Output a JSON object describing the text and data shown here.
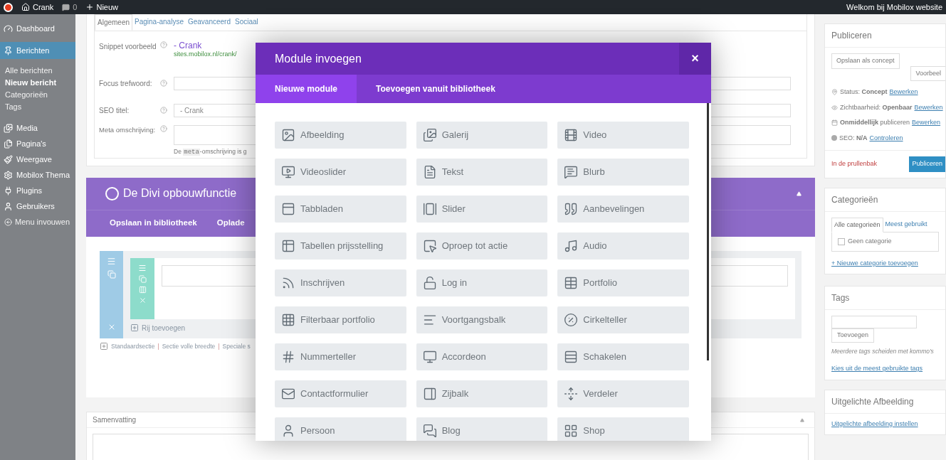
{
  "top_bar": {
    "site": "Crank",
    "comments": "0",
    "new": "Nieuw",
    "greeting": "Welkom bij Mobilox website"
  },
  "sidebar": {
    "items": [
      {
        "label": "Dashboard",
        "selected": false
      },
      {
        "label": "Berichten",
        "selected": true,
        "children": [
          {
            "label": "Alle berichten",
            "selected": false
          },
          {
            "label": "Nieuw bericht",
            "selected": true
          },
          {
            "label": "Categorieën",
            "selected": false
          },
          {
            "label": "Tags",
            "selected": false
          }
        ]
      },
      {
        "label": "Media",
        "selected": false
      },
      {
        "label": "Pagina's",
        "selected": false
      },
      {
        "label": "Weergave",
        "selected": false
      },
      {
        "label": "Mobilox Thema",
        "selected": false
      },
      {
        "label": "Plugins",
        "selected": false
      },
      {
        "label": "Gebruikers",
        "selected": false
      }
    ],
    "collapse": "Menu invouwen"
  },
  "seo_box": {
    "tabs": [
      {
        "label": "Algemeen",
        "selected": true
      },
      {
        "label": "Pagina-analyse",
        "selected": false
      },
      {
        "label": "Geavanceerd",
        "selected": false
      },
      {
        "label": "Sociaal",
        "selected": false
      }
    ],
    "snippet_label": "Snippet voorbeeld",
    "snippet_title": "- Crank",
    "snippet_url": "sites.mobilox.nl/crank/",
    "focus_label": "Focus trefwoord:",
    "seo_title_label": "SEO titel:",
    "seo_title_placeholder": "- Crank",
    "meta_label": "Meta omschrijving:",
    "meta_hint": {
      "before": "De",
      "code": "meta",
      "after": "-omschrijving is g"
    }
  },
  "divi": {
    "title": "De Divi opbouwfunctie",
    "buttons": [
      "Opslaan in bibliotheek",
      "Oplade"
    ],
    "add_row": "Rij toevoegen",
    "section_links": [
      "Standaardsectie",
      "Sectie volle breedte",
      "Speciale s"
    ],
    "separator": "|"
  },
  "excerpt": {
    "title": "Samenvatting"
  },
  "publish": {
    "title": "Publiceren",
    "save_draft": "Opslaan als concept",
    "preview": "Voorbeel",
    "rows": [
      {
        "text": "Status: **Concept**",
        "link": "Bewerken"
      },
      {
        "text": "Zichtbaarheid: **Openbaar**",
        "link": "Bewerken"
      },
      {
        "text": "**Onmiddellijk** publiceren",
        "link": "Bewerken"
      },
      {
        "text": "SEO: **N/A**",
        "link": "Controleren"
      }
    ],
    "trash": "In de prullenbak",
    "publish_button": "Publiceren"
  },
  "categories": {
    "title": "Categorieën",
    "tabs": [
      {
        "label": "Alle categorieën",
        "selected": true
      },
      {
        "label": "Meest gebruikt",
        "selected": false
      }
    ],
    "items": [
      {
        "label": "Geen categorie",
        "checked": false
      }
    ],
    "add_link": "+ Nieuwe categorie toevoegen"
  },
  "tags": {
    "title": "Tags",
    "add_button": "Toevoegen",
    "hint": "Meerdere tags scheiden met kommo's",
    "popular_link": "Kies uit de meest gebruikte tags"
  },
  "featured_image": {
    "title": "Uitgelichte Afbeelding",
    "link": "Uitgelichte afbeelding instellen"
  },
  "modal": {
    "title": "Module invoegen",
    "close": "×",
    "tabs": [
      {
        "label": "Nieuwe module",
        "selected": true
      },
      {
        "label": "Toevoegen vanuit bibliotheek",
        "selected": false
      }
    ],
    "modules": [
      "Afbeelding",
      "Galerij",
      "Video",
      "Videoslider",
      "Tekst",
      "Blurb",
      "Tabbladen",
      "Slider",
      "Aanbevelingen",
      "Tabellen prijsstelling",
      "Oproep tot actie",
      "Audio",
      "Inschrijven",
      "Log in",
      "Portfolio",
      "Filterbaar portfolio",
      "Voortgangsbalk",
      "Cirkelteller",
      "Nummerteller",
      "Accordeon",
      "Schakelen",
      "Contactformulier",
      "Zijbalk",
      "Verdeler",
      "Persoon",
      "Blog",
      "Shop"
    ]
  }
}
